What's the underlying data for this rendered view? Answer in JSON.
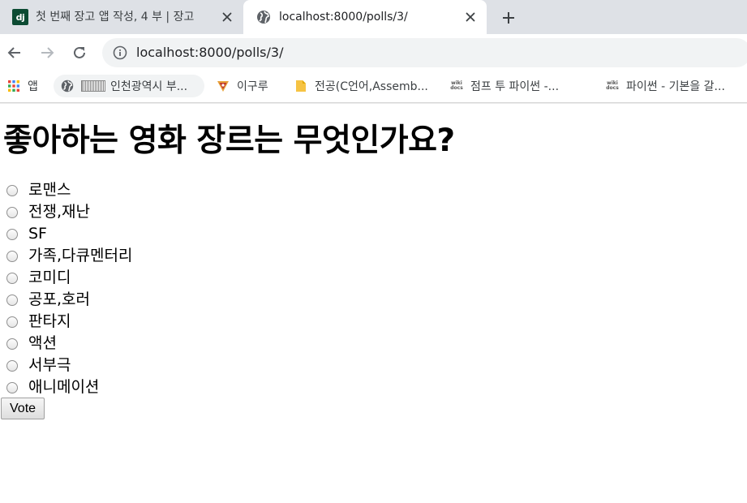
{
  "browser": {
    "tabs": [
      {
        "favicon": "django-icon",
        "title": "첫 번째 장고 앱 작성, 4 부 | 장고",
        "active": false
      },
      {
        "favicon": "globe-icon",
        "title": "localhost:8000/polls/3/",
        "active": true
      }
    ],
    "address_bar": {
      "url": "localhost:8000/polls/3/"
    },
    "bookmarks": [
      {
        "icon": "apps-grid-icon",
        "label": "앱"
      },
      {
        "icon": "globe-icon",
        "label": "인천광역시 부..."
      },
      {
        "icon": "igloo-icon",
        "label": "이구루"
      },
      {
        "icon": "folder-icon",
        "label": "전공(C언어,Assemb..."
      },
      {
        "icon": "wikidocs-icon",
        "label": "점프 투 파이썬 -..."
      },
      {
        "icon": "wikidocs-icon",
        "label": "파이썬 - 기본을 갈..."
      }
    ]
  },
  "page": {
    "question": "좋아하는 영화 장르는 무엇인가요?",
    "choices": [
      "로맨스",
      "전쟁,재난",
      "SF",
      "가족,다큐멘터리",
      "코미디",
      "공포,호러",
      "판타지",
      "액션",
      "서부극",
      "애니메이션"
    ],
    "vote_label": "Vote"
  },
  "colors": {
    "tabstrip": "#dee1e6",
    "omnibox": "#f1f3f4",
    "django_green": "#0c4b33"
  }
}
